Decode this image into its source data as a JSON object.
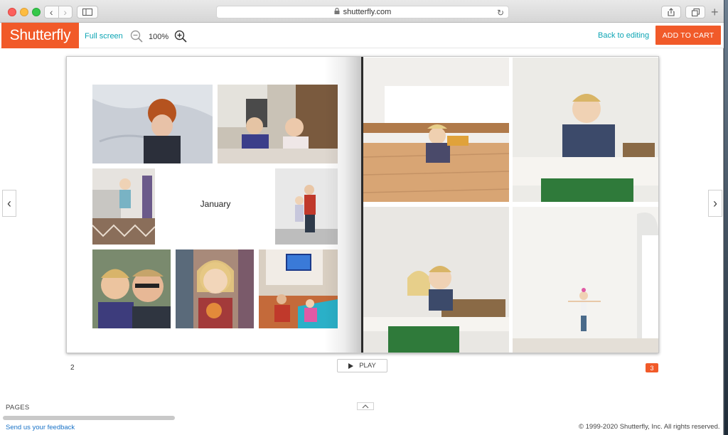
{
  "browser": {
    "url": "shutterfly.com"
  },
  "header": {
    "logo_text": "Shutterfly",
    "full_screen_label": "Full screen",
    "zoom_level": "100%",
    "back_to_editing_label": "Back to editing",
    "add_to_cart_label": "ADD TO CART"
  },
  "book": {
    "month_label": "January",
    "left_page_number": "2",
    "right_page_number": "3"
  },
  "player": {
    "play_label": "PLAY"
  },
  "footer": {
    "pages_label": "PAGES",
    "feedback_link": "Send us your feedback",
    "copyright": "© 1999-2020 Shutterfly, Inc. All rights reserved."
  },
  "colors": {
    "brand_orange": "#f15a29",
    "link_teal": "#0ea5b4"
  }
}
